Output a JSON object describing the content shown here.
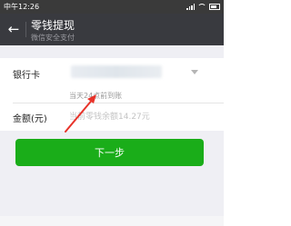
{
  "status_bar": {
    "time": "中午12:26"
  },
  "header": {
    "title": "零钱提现",
    "subtitle": "微信安全支付"
  },
  "form": {
    "bank_label": "银行卡",
    "hint": "当天24点前到账",
    "amount_label": "金额(元)",
    "amount_placeholder": "当前零钱余额14.27元"
  },
  "next_button_label": "下一步",
  "colors": {
    "nav_bg": "#393a3f",
    "primary_button": "#1aad19",
    "annotation": "#e8332a"
  }
}
